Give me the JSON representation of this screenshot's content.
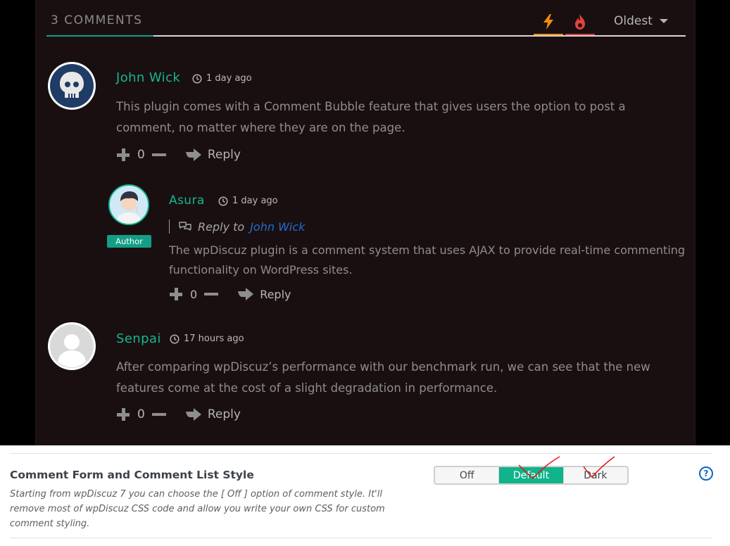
{
  "comments_header": {
    "count_label": "3 COMMENTS",
    "sort_order": "Oldest",
    "sort_icons": [
      "bolt-icon",
      "fire-icon"
    ]
  },
  "comments": [
    {
      "author": "John Wick",
      "time": "1 day ago",
      "text_lines": [
        "This plugin comes with a Comment Bubble feature that gives users the option to post a",
        "comment, no matter where they are on the page."
      ],
      "votes": "0",
      "reply_label": "Reply",
      "avatar_icon": "skull-avatar"
    },
    {
      "author": "Asura",
      "time": "1 day ago",
      "badge": "Author",
      "reply_to_label": "Reply to",
      "reply_to_name": "John Wick",
      "text_lines": [
        "The wpDiscuz plugin is a comment system that uses AJAX to provide real-time commenting",
        "functionality on WordPress sites."
      ],
      "votes": "0",
      "reply_label": "Reply",
      "avatar_icon": "anime-avatar"
    },
    {
      "author": "Senpai",
      "time": "17 hours ago",
      "text_lines": [
        "After comparing wpDiscuz’s performance with our benchmark run, we can see that the new",
        "features come at the cost of a slight degradation in performance."
      ],
      "votes": "0",
      "reply_label": "Reply",
      "avatar_icon": "default-user-avatar"
    }
  ],
  "settings": {
    "title": "Comment Form and Comment List Style",
    "description": "Starting from wpDiscuz 7 you can choose the [ Off ] option of comment style. It'll remove most of wpDiscuz CSS code and allow you write your own CSS for custom comment styling.",
    "options": [
      "Off",
      "Default",
      "Dark"
    ],
    "selected": "Default",
    "help_icon": "?"
  },
  "colors": {
    "accent": "#13b78f",
    "bolt": "#f08c0a",
    "fire": "#d93b35",
    "link": "#1f6ed0",
    "annotation": "#e0131b"
  }
}
